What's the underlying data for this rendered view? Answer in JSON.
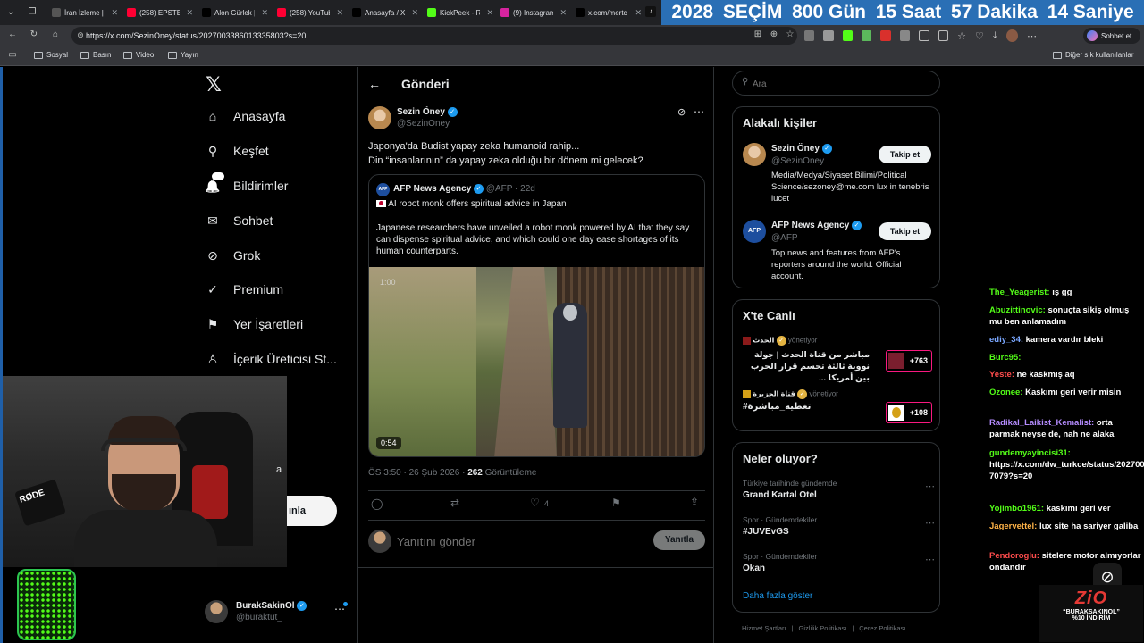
{
  "browser": {
    "tabs": [
      {
        "title": "İran İzleme |",
        "fav_color": "#555555"
      },
      {
        "title": "(258) EPSTEIN",
        "fav_color": "#ff0033"
      },
      {
        "title": "Alon Gürlek |",
        "fav_color": "#000000"
      },
      {
        "title": "(258) YouTub",
        "fav_color": "#ff0033"
      },
      {
        "title": "Anasayfa / X",
        "fav_color": "#000000"
      },
      {
        "title": "KickPeek - R",
        "fav_color": "#53fc18"
      },
      {
        "title": "(9) Instagram",
        "fav_color": "#d6249f"
      },
      {
        "title": "x.com/mertc",
        "fav_color": "#000000"
      }
    ],
    "countdown": [
      "2028",
      "SEÇİM",
      "800 Gün",
      "15 Saat",
      "57 Dakika",
      "14 Saniye"
    ],
    "url": "https://x.com/SezinOney/status/2027003386013335803?s=20",
    "chat_button": "Sohbet et",
    "bookmarks": [
      "Sosyal",
      "Basın",
      "Video",
      "Yayın"
    ],
    "other_bookmarks": "Diğer sık kullanılanlar"
  },
  "nav": {
    "items": [
      {
        "label": "Anasayfa",
        "icon": "home-icon"
      },
      {
        "label": "Keşfet",
        "icon": "search-icon"
      },
      {
        "label": "Bildirimler",
        "icon": "bell-icon"
      },
      {
        "label": "Sohbet",
        "icon": "mail-icon"
      },
      {
        "label": "Grok",
        "icon": "grok-icon"
      },
      {
        "label": "Premium",
        "icon": "premium-icon"
      },
      {
        "label": "Yer İşaretleri",
        "icon": "bookmark-icon"
      },
      {
        "label": "İçerik Üreticisi St...",
        "icon": "creator-icon"
      }
    ],
    "notif_count": "10",
    "post_button_partial": "ınla",
    "account": {
      "name": "BurakSakinOl",
      "handle": "@buraktut_"
    }
  },
  "post": {
    "header": "Gönderi",
    "author": "Sezin Öney",
    "handle": "@SezinOney",
    "text_line1": "Japonya'da Budist yapay zeka humanoid rahip...",
    "text_line2": "Din “insanlarının” da yapay zeka olduğu bir dönem mi gelecek?",
    "quote": {
      "author": "AFP News Agency",
      "handle": "@AFP",
      "age": "22d",
      "headline": "AI robot monk offers spiritual advice in Japan",
      "body": "Japanese researchers have unveiled a robot monk powered by AI that they say can dispense spiritual advice, and which could one day ease shortages of its human counterparts.",
      "video_time_overlay": "1:00",
      "video_duration": "0:54"
    },
    "timestamp": "ÖS 3:50 · 26 Şub 2026 ·",
    "views_count": "262",
    "views_label": "Görüntüleme",
    "likes": "4",
    "reply_placeholder": "Yanıtını gönder",
    "reply_button": "Yanıtla"
  },
  "sidebar": {
    "search_placeholder": "Ara",
    "related_title": "Alakalı kişiler",
    "related": [
      {
        "name": "Sezin Öney",
        "handle": "@SezinOney",
        "bio": "Media/Medya/Siyaset Bilimi/Political Science/sezoney@me.com lux in tenebris lucet",
        "button": "Takip et"
      },
      {
        "name": "AFP News Agency",
        "handle": "@AFP",
        "bio": "Top news and features from AFP's reporters around the world. Official account.",
        "button": "Takip et"
      }
    ],
    "live_title": "X'te Canlı",
    "live": [
      {
        "host": "الحدث",
        "status": "yönetiyor",
        "title": "مباشر من قناة الحدث | جولة نووية ثالثة تحسم قرار الحرب بين أمريكا ...",
        "count": "+763"
      },
      {
        "host": "قناة الجزيرة",
        "status": "yönetiyor",
        "title": "#تغطية_مباشرة",
        "count": "+108"
      }
    ],
    "trends_title": "Neler oluyor?",
    "trends": [
      {
        "context": "Türkiye tarihinde gündemde",
        "name": "Grand Kartal Otel"
      },
      {
        "context": "Spor · Gündemdekiler",
        "name": "#JUVEvGS"
      },
      {
        "context": "Spor · Gündemdekiler",
        "name": "Okan"
      }
    ],
    "show_more": "Daha fazla göster",
    "footer": [
      "Hizmet Şartları",
      "Gizlilik Politikası",
      "Çerez Politikası"
    ]
  },
  "chat": [
    {
      "user": "The_Yeagerist:",
      "msg": "ış gg",
      "color": "#53fc18"
    },
    {
      "user": "Abuzittinovic:",
      "msg": "sonuçta sikiş olmuş mu ben anlamadım",
      "color": "#53fc18"
    },
    {
      "user": "ediy_34:",
      "msg": "kamera vardır bleki",
      "color": "#7aa7ff"
    },
    {
      "user": "Burc95:",
      "msg": "",
      "color": "#53fc18"
    },
    {
      "user": "Yeste:",
      "msg": "ne kaskmış aq",
      "color": "#ff4d4d"
    },
    {
      "user": "Ozonee:",
      "msg": "Kaskımı geri verir misin",
      "color": "#53fc18"
    },
    {
      "user": "Radikal_Laikist_Kemalist:",
      "msg": "orta parmak neyse de, nah ne alaka",
      "color": "#b58cff"
    },
    {
      "user": "gundemyayincisi31:",
      "msg": "https://x.com/dw_turkce/status/202700588339416 7079?s=20",
      "color": "#53fc18"
    },
    {
      "user": "Yojimbo1961:",
      "msg": "kaskımı geri ver",
      "color": "#53fc18"
    },
    {
      "user": "Jagervettel:",
      "msg": "lux site ha sariyer galiba",
      "color": "#ffb347"
    },
    {
      "user": "Pendoroglu:",
      "msg": "sitelere motor almıyorlar ondandır",
      "color": "#ff4d4d"
    }
  ],
  "promo": {
    "logo": "ZiO",
    "line1": "“BURAKSAKINOL”",
    "line2": "%10 İNDİRİM"
  },
  "colors": {
    "accent": "#1d9bf0",
    "countdown_bg": "#2a6fb5",
    "kick_green": "#53fc18"
  }
}
